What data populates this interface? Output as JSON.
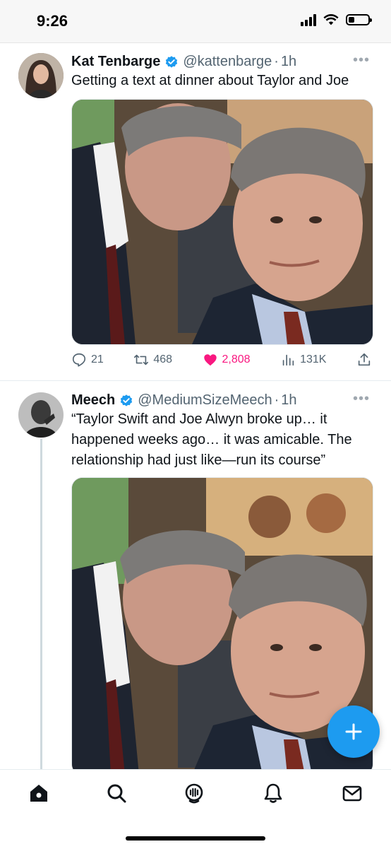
{
  "status_bar": {
    "time": "9:26",
    "battery_level": 0.3
  },
  "tweets": [
    {
      "name": "Kat Tenbarge",
      "handle": "@kattenbarge",
      "separator": "·",
      "time": "1h",
      "text": "Getting a text at dinner about Taylor and Joe",
      "replies": "21",
      "retweets": "468",
      "likes": "2,808",
      "views": "131K",
      "liked": true
    },
    {
      "name": "Meech",
      "handle": "@MediumSizeMeech",
      "separator": "·",
      "time": "1h",
      "text": "“Taylor Swift and Joe Alwyn broke up… it happened weeks ago… it was amicable. The relationship had just like—run its course”"
    }
  ],
  "colors": {
    "accent": "#1d9bf0",
    "like": "#f91880",
    "muted": "#536471"
  },
  "icons": {
    "more": "more-icon",
    "verified": "verified-badge-icon"
  },
  "tabbar": [
    "home-icon",
    "search-icon",
    "spaces-icon",
    "notifications-icon",
    "messages-icon"
  ]
}
